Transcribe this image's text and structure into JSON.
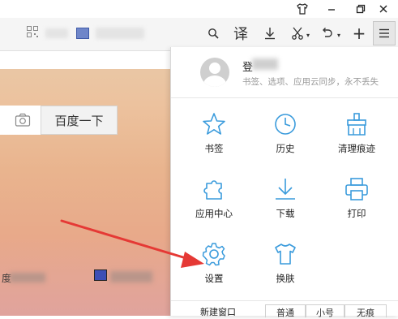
{
  "titlebar": {
    "skin_icon": "skin-shirt-icon",
    "min_icon": "minimize-icon",
    "max_icon": "restore-icon",
    "close_icon": "close-icon"
  },
  "toolbar": {
    "qr_icon": "qr-code-icon",
    "translate_label": "译",
    "search_icon": "search-icon",
    "download_icon": "download-icon",
    "cut_icon": "scissors-icon",
    "undo_icon": "undo-icon",
    "new_tab_label": "+",
    "menu_icon": "hamburger-menu-icon"
  },
  "page": {
    "search_button_label": "百度一下",
    "camera_icon": "camera-icon",
    "bottom_left_text": "度"
  },
  "menu": {
    "login": {
      "title": "登",
      "subtitle": "书签、选项、应用云同步，永不丢失"
    },
    "items": [
      {
        "label": "书签",
        "icon": "star-icon"
      },
      {
        "label": "历史",
        "icon": "clock-icon"
      },
      {
        "label": "清理痕迹",
        "icon": "broom-icon"
      },
      {
        "label": "应用中心",
        "icon": "puzzle-icon"
      },
      {
        "label": "下载",
        "icon": "download-icon"
      },
      {
        "label": "打印",
        "icon": "printer-icon"
      },
      {
        "label": "设置",
        "icon": "gear-icon"
      },
      {
        "label": "换肤",
        "icon": "tshirt-icon"
      }
    ],
    "footer": {
      "new_window": "新建窗口",
      "zoom_normal": "普通",
      "zoom_small": "小号",
      "zoom_none": "无痕"
    }
  },
  "colors": {
    "accent": "#3a9bdc",
    "arrow": "#e53935"
  }
}
